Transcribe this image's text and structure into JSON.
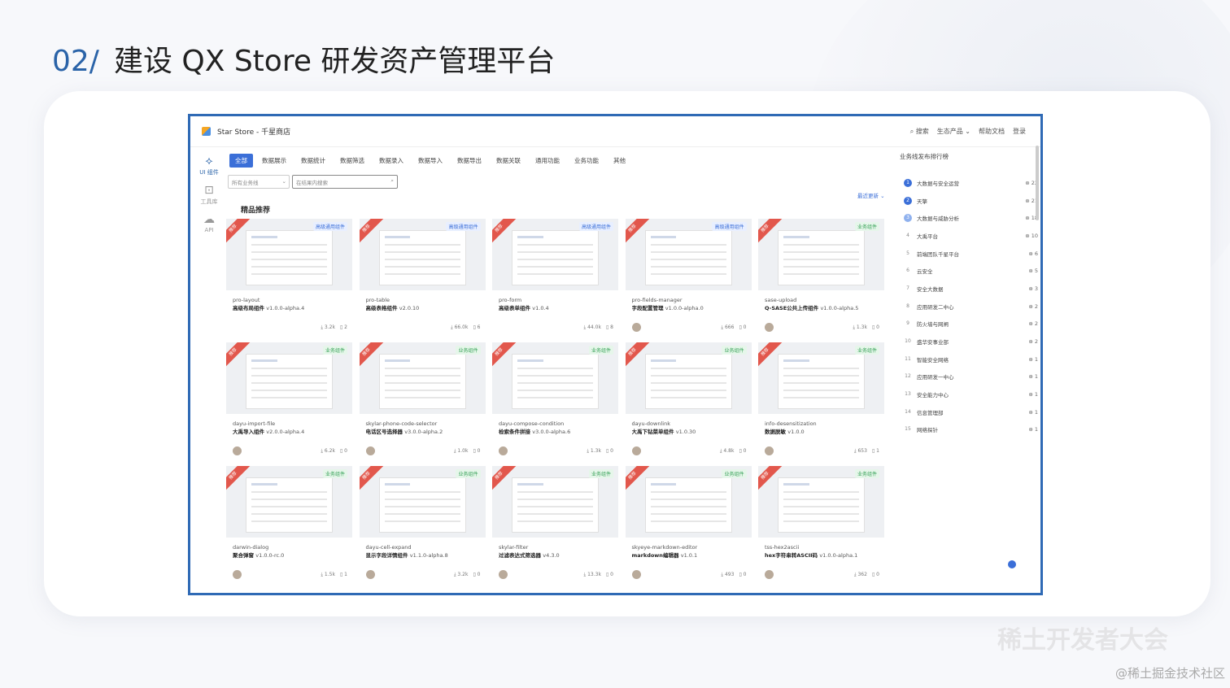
{
  "slide": {
    "number": "02/",
    "title": "建设 QX Store 研发资产管理平台"
  },
  "app": {
    "title": "Star Store - 千星商店",
    "nav": [
      "搜索",
      "生态产品",
      "帮助文档",
      "登录"
    ],
    "rail": [
      {
        "label": "UI 组件",
        "icon": "puzzle-icon"
      },
      {
        "label": "工具库",
        "icon": "terminal-icon"
      },
      {
        "label": "API",
        "icon": "cloud-api-icon"
      }
    ]
  },
  "tabs": [
    "全部",
    "数据展示",
    "数据统计",
    "数据筛选",
    "数据录入",
    "数据导入",
    "数据导出",
    "数据关联",
    "通用功能",
    "业务功能",
    "其他"
  ],
  "filters": {
    "business_line": "所有业务线",
    "search_placeholder": "在结果内搜索"
  },
  "sort": "最近更新",
  "section": "精品推荐",
  "ribbon_label": "推荐",
  "cards": [
    {
      "name": "pro-layout",
      "desc": "高级布局组件",
      "ver": "v1.0.0-alpha.4",
      "cat": "高级通用组件",
      "cat_type": "adv",
      "downloads": "3.2k",
      "stars": "2"
    },
    {
      "name": "pro-table",
      "desc": "高级表格组件",
      "ver": "v2.0.10",
      "cat": "高级通用组件",
      "cat_type": "adv",
      "downloads": "66.0k",
      "stars": "6"
    },
    {
      "name": "pro-form",
      "desc": "高级表单组件",
      "ver": "v1.0.4",
      "cat": "高级通用组件",
      "cat_type": "adv",
      "downloads": "44.0k",
      "stars": "8"
    },
    {
      "name": "pro-fields-manager",
      "desc": "字段配置管理",
      "ver": "v1.0.0-alpha.0",
      "cat": "高级通用组件",
      "cat_type": "adv",
      "downloads": "666",
      "stars": "0"
    },
    {
      "name": "sase-upload",
      "desc": "Q-SASE公共上传组件",
      "ver": "v1.0.0-alpha.5",
      "cat": "业务组件",
      "cat_type": "biz",
      "downloads": "1.3k",
      "stars": "0"
    },
    {
      "name": "dayu-import-file",
      "desc": "大禹导入组件",
      "ver": "v2.0.0-alpha.4",
      "cat": "业务组件",
      "cat_type": "biz",
      "downloads": "6.2k",
      "stars": "0"
    },
    {
      "name": "skylar-phone-code-selector",
      "desc": "电话区号选择器",
      "ver": "v3.0.0-alpha.2",
      "cat": "业务组件",
      "cat_type": "biz",
      "downloads": "1.0k",
      "stars": "0"
    },
    {
      "name": "dayu-compose-condition",
      "desc": "检索条件拼接",
      "ver": "v3.0.0-alpha.6",
      "cat": "业务组件",
      "cat_type": "biz",
      "downloads": "1.3k",
      "stars": "0"
    },
    {
      "name": "dayu-downlink",
      "desc": "大禹下钻菜单组件",
      "ver": "v1.0.30",
      "cat": "业务组件",
      "cat_type": "biz",
      "downloads": "4.8k",
      "stars": "0"
    },
    {
      "name": "info-desensitization",
      "desc": "数据脱敏",
      "ver": "v1.0.0",
      "cat": "业务组件",
      "cat_type": "biz",
      "downloads": "653",
      "stars": "1"
    },
    {
      "name": "darwin-dialog",
      "desc": "聚合弹窗",
      "ver": "v1.0.0-rc.0",
      "cat": "业务组件",
      "cat_type": "biz",
      "downloads": "1.5k",
      "stars": "1"
    },
    {
      "name": "dayu-cell-expand",
      "desc": "显示字段详情组件",
      "ver": "v1.1.0-alpha.8",
      "cat": "业务组件",
      "cat_type": "biz",
      "downloads": "3.2k",
      "stars": "0"
    },
    {
      "name": "skylar-filter",
      "desc": "过滤表达式筛选器",
      "ver": "v4.3.0",
      "cat": "业务组件",
      "cat_type": "biz",
      "downloads": "13.3k",
      "stars": "0"
    },
    {
      "name": "skyeye-markdown-editor",
      "desc": "markdown编辑器",
      "ver": "v1.0.1",
      "cat": "业务组件",
      "cat_type": "biz",
      "downloads": "493",
      "stars": "0"
    },
    {
      "name": "tss-hex2ascii",
      "desc": "hex字符串转ASCII码",
      "ver": "v1.0.0-alpha.1",
      "cat": "业务组件",
      "cat_type": "biz",
      "downloads": "362",
      "stars": "0"
    }
  ],
  "ranking": {
    "title": "业务线发布排行榜",
    "items": [
      {
        "rank": "1",
        "name": "大数据与安全运营",
        "count": "22"
      },
      {
        "rank": "2",
        "name": "天擎",
        "count": "21"
      },
      {
        "rank": "3",
        "name": "大数据与威胁分析",
        "count": "18"
      },
      {
        "rank": "4",
        "name": "大禹平台",
        "count": "10"
      },
      {
        "rank": "5",
        "name": "前端团队千星平台",
        "count": "6"
      },
      {
        "rank": "6",
        "name": "云安全",
        "count": "5"
      },
      {
        "rank": "7",
        "name": "安全大数据",
        "count": "3"
      },
      {
        "rank": "8",
        "name": "应用研发二中心",
        "count": "2"
      },
      {
        "rank": "9",
        "name": "防火墙与网闸",
        "count": "2"
      },
      {
        "rank": "10",
        "name": "盛华安事业部",
        "count": "2"
      },
      {
        "rank": "11",
        "name": "智能安全网络",
        "count": "1"
      },
      {
        "rank": "12",
        "name": "应用研发一中心",
        "count": "1"
      },
      {
        "rank": "13",
        "name": "安全能力中心",
        "count": "1"
      },
      {
        "rank": "14",
        "name": "信息管理部",
        "count": "1"
      },
      {
        "rank": "15",
        "name": "网络探针",
        "count": "1"
      }
    ]
  },
  "watermark": {
    "main": "稀土开发者大会",
    "credit": "@稀土掘金技术社区"
  },
  "colors": {
    "accent": "#2f6ab5",
    "tab_active": "#3b6fd8",
    "ribbon": "#e2574c"
  }
}
